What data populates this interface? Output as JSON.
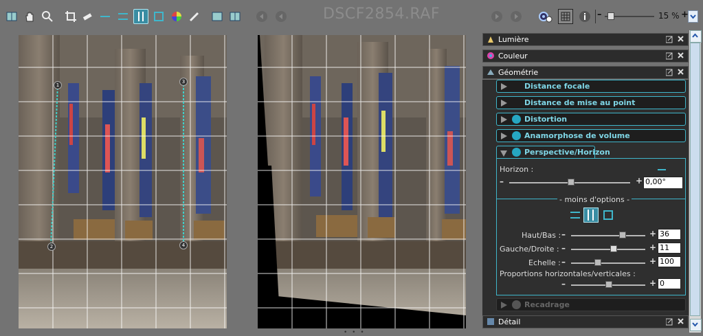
{
  "toolbar": {
    "filename": "DSCF2854.RAF",
    "zoom_value": "15 %",
    "icons": [
      "compare-icon",
      "hand-icon",
      "zoom-icon",
      "crop-icon",
      "eraser-icon",
      "horizon-line-icon",
      "horizontal-guides-icon",
      "vertical-guides-icon",
      "rectangle-guides-icon",
      "color-wheel-icon",
      "picker-icon",
      "before-icon",
      "after-icon",
      "first-image-icon",
      "previous-image-icon",
      "next-image-icon",
      "last-image-icon",
      "settings-icon",
      "grid-icon",
      "info-icon"
    ]
  },
  "panel": {
    "lumiere": "Lumière",
    "couleur": "Couleur",
    "geometrie": "Géométrie",
    "detail": "Détail",
    "sub": {
      "distance_focale": "Distance focale",
      "distance_mise_au_point": "Distance de mise au point",
      "distortion": "Distortion",
      "anamorphose": "Anamorphose de volume",
      "perspective": "Perspective/Horizon",
      "recadrage": "Recadrage"
    },
    "horizon": {
      "label": "Horizon :",
      "value": "0,00°"
    },
    "options_label": "- moins d'options -",
    "haut_bas": {
      "label": "Haut/Bas :",
      "value": "36"
    },
    "gauche_droite": {
      "label": "Gauche/Droite :",
      "value": "11"
    },
    "echelle": {
      "label": "Echelle :",
      "value": "100"
    },
    "proportions": {
      "label": "Proportions horizontales/verticales :",
      "value": "0"
    }
  },
  "guides": {
    "numbers": [
      "1",
      "2",
      "3",
      "4"
    ]
  },
  "colors": {
    "accent": "#3fb7cc",
    "active_icon": "#3a8da3"
  }
}
